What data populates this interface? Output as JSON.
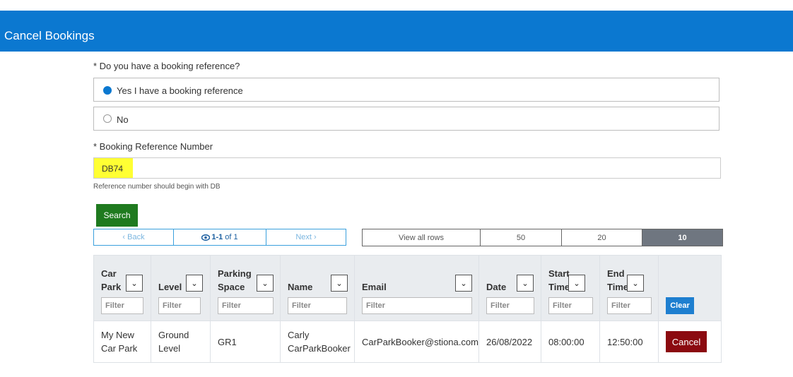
{
  "header": {
    "title": "Cancel Bookings"
  },
  "form": {
    "question_label": "* Do you have a booking reference?",
    "options": [
      {
        "label": "Yes I have a booking reference",
        "selected": true
      },
      {
        "label": "No",
        "selected": false
      }
    ],
    "ref_label": "* Booking Reference Number",
    "ref_value": "DB74",
    "ref_hint": "Reference number should begin with DB",
    "search_label": "Search"
  },
  "pager": {
    "back_label": "‹ Back",
    "range": "1-1",
    "of_label": "of 1",
    "next_label": "Next ›"
  },
  "row_sizes": {
    "options": [
      "View all rows",
      "50",
      "20",
      "10"
    ],
    "selected": "10"
  },
  "table": {
    "columns": [
      {
        "label": "Car Park",
        "filter_placeholder": "Filter"
      },
      {
        "label": "Level",
        "filter_placeholder": "Filter"
      },
      {
        "label": "Parking Space",
        "filter_placeholder": "Filter"
      },
      {
        "label": "Name",
        "filter_placeholder": "Filter"
      },
      {
        "label": "Email",
        "filter_placeholder": "Filter"
      },
      {
        "label": "Date",
        "filter_placeholder": "Filter"
      },
      {
        "label": "Start Time",
        "filter_placeholder": "Filter"
      },
      {
        "label": "End Time",
        "filter_placeholder": "Filter"
      }
    ],
    "clear_label": "Clear",
    "rows": [
      {
        "car_park": "My New Car Park",
        "level": "Ground Level",
        "space": "GR1",
        "name": "Carly CarParkBooker",
        "email": "CarParkBooker@stiona.com",
        "date": "26/08/2022",
        "start": "08:00:00",
        "end": "12:50:00",
        "action_label": "Cancel"
      }
    ]
  },
  "colors": {
    "header": "#0b78d0",
    "search": "#1f7a1f",
    "cancel": "#8b0a10",
    "highlight": "#ffff33"
  }
}
